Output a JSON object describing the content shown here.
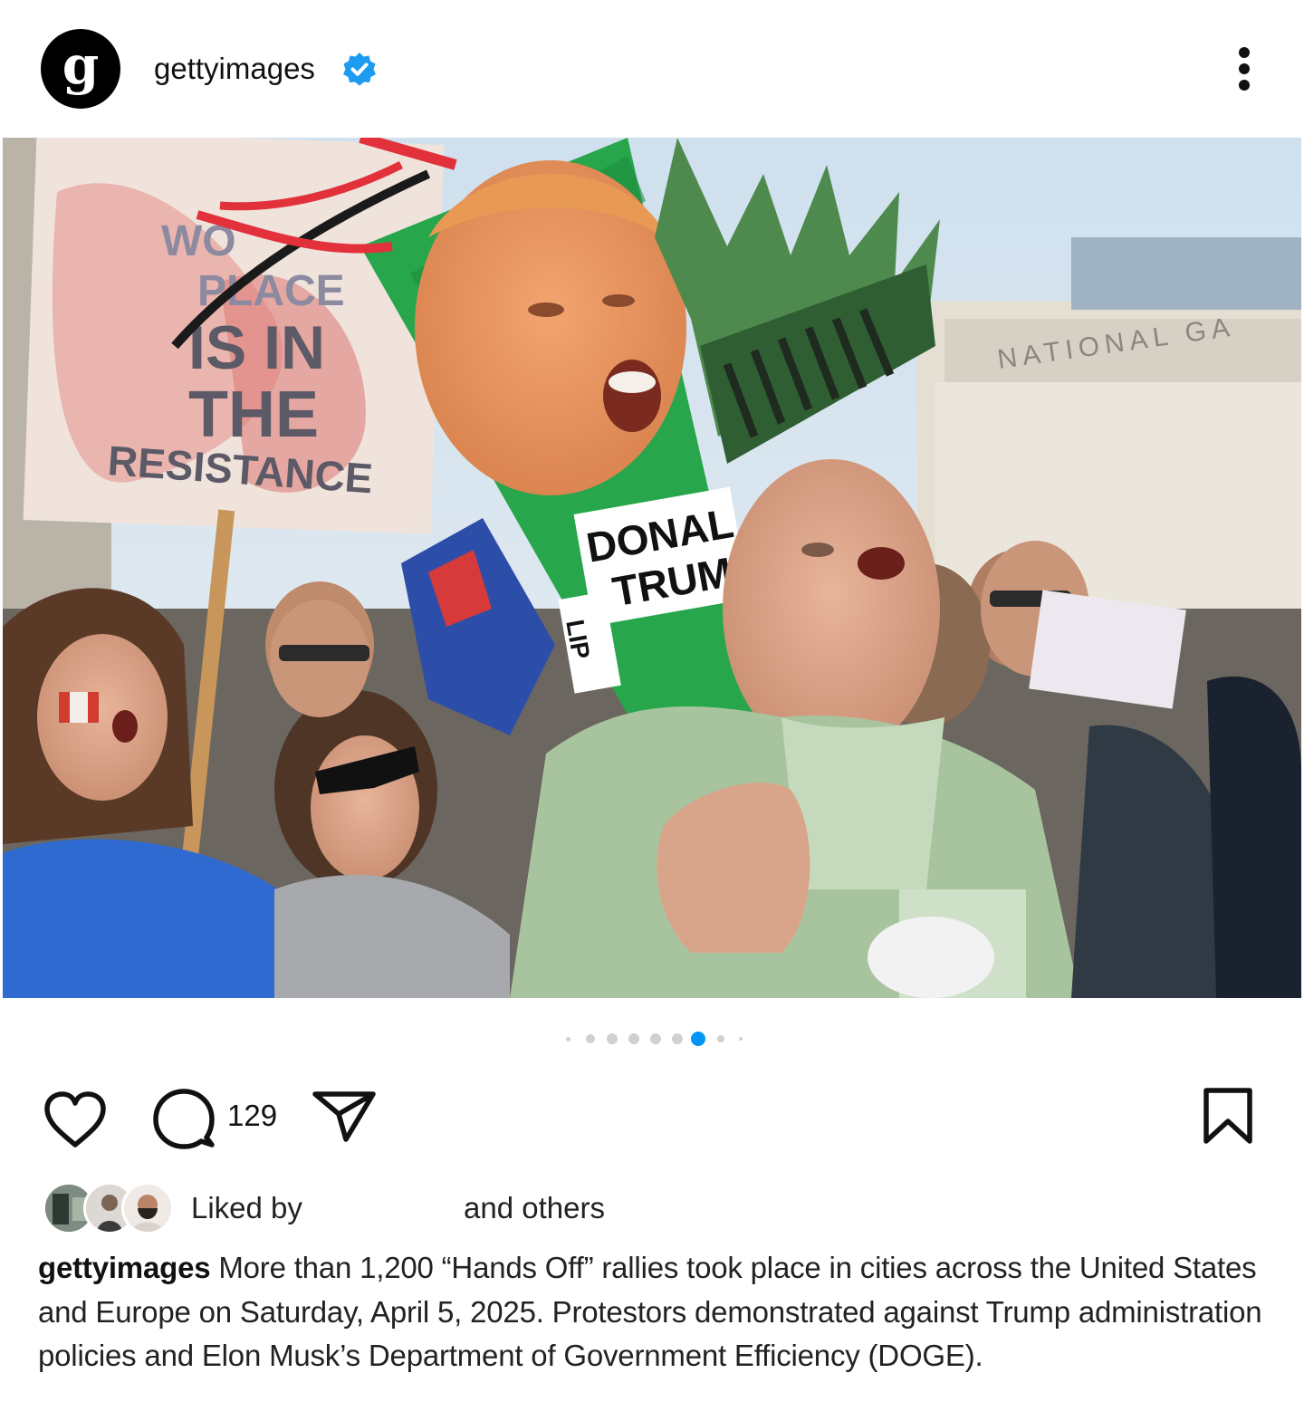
{
  "post": {
    "account": {
      "avatar_letter": "g",
      "username": "gettyimages",
      "verified": true,
      "verified_icon": "verified-badge-icon",
      "verified_color": "#1D9BF0"
    },
    "more_icon": "more-vertical-icon",
    "photo": {
      "sign_lines": [
        "WO",
        "PLACE",
        "IS IN",
        "THE",
        "RESISTANCE"
      ],
      "cone_label_lines": [
        "DONAL",
        "TRUM"
      ],
      "cone_tag": "LIP",
      "building_text": "NATIONAL GA"
    },
    "carousel": {
      "total_dots": 9,
      "active_index": 6,
      "active_color": "#0095F6"
    },
    "actions": {
      "like_icon": "heart-icon",
      "comment_icon": "comment-icon",
      "comment_count": "129",
      "share_icon": "send-icon",
      "save_icon": "bookmark-icon"
    },
    "likes": {
      "liked_by_label": "Liked by",
      "others_label": "and others"
    },
    "caption": {
      "username": "gettyimages",
      "text": "More than 1,200 “Hands Off” rallies took place in cities across the United States and Europe on Saturday, April 5, 2025. Protestors demonstrated against Trump administration policies and Elon Musk’s Department of Government Efficiency (DOGE)."
    }
  }
}
